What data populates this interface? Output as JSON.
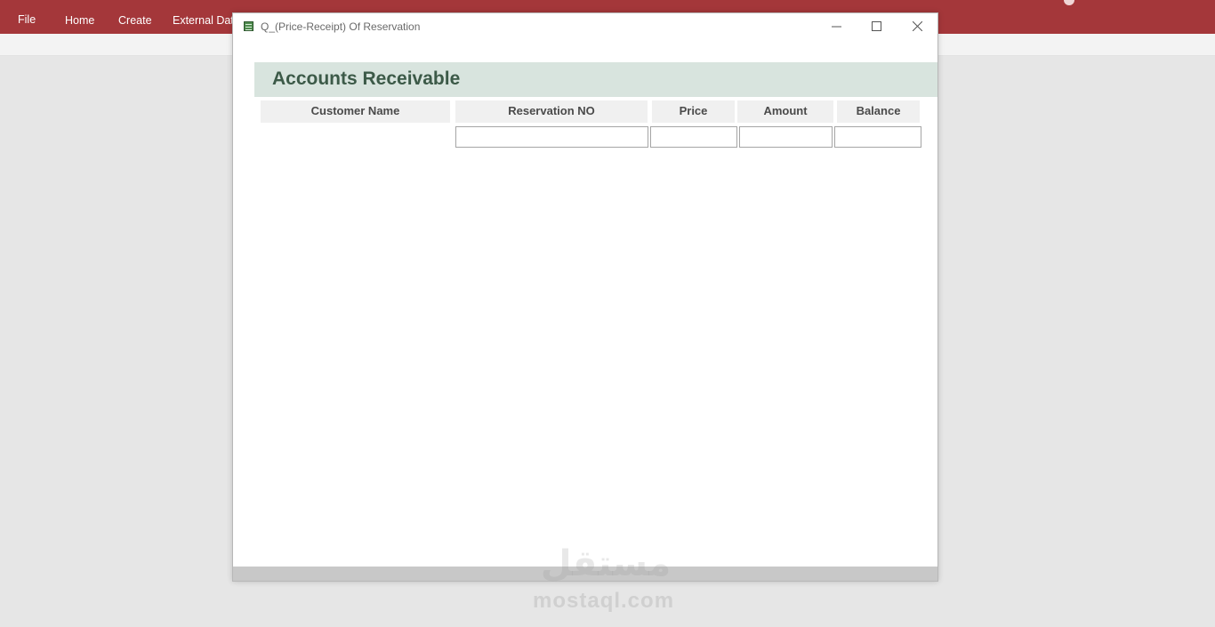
{
  "ribbon": {
    "tabs": [
      "File",
      "Home",
      "Create",
      "External Data"
    ],
    "color": "#a4373a"
  },
  "window": {
    "title": "Q_(Price-Receipt) Of Reservation",
    "icon": "form-icon",
    "controls": [
      "minimize-icon",
      "maximize-icon",
      "close-icon"
    ]
  },
  "form": {
    "title": "Accounts Receivable",
    "header_color": "#d8e4de",
    "columns": [
      "Customer Name",
      "Reservation NO",
      "Price",
      "Amount",
      "Balance"
    ],
    "fields": {
      "reservation_no": "",
      "price": "",
      "amount": "",
      "balance": ""
    }
  },
  "watermark": {
    "text": "mostaql.com",
    "mark": "مستقل"
  }
}
